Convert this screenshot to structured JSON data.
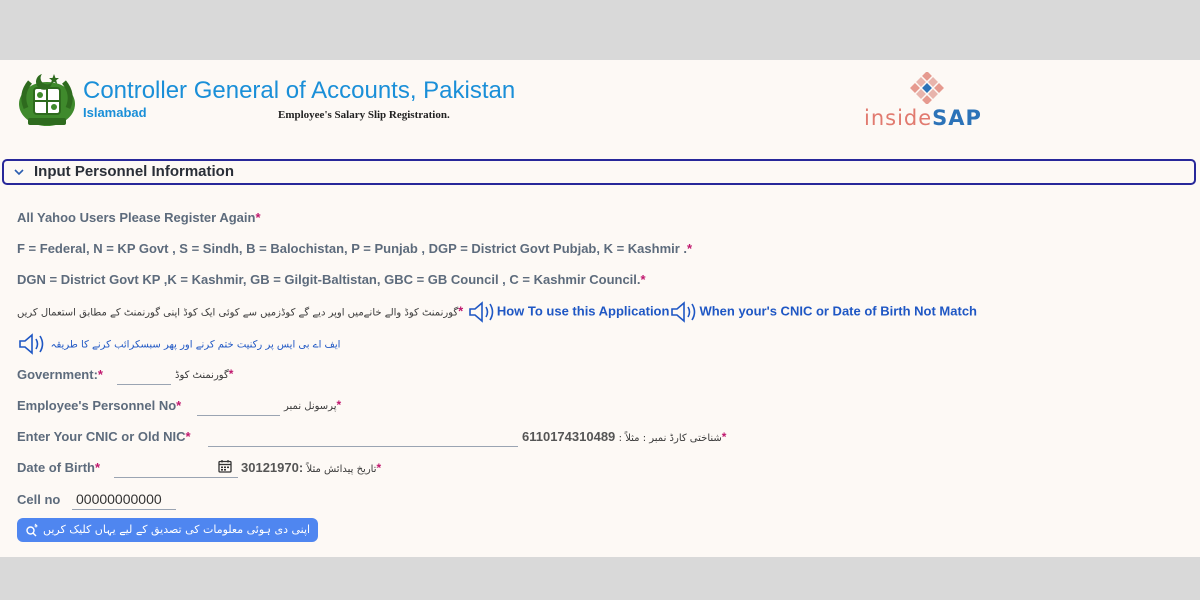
{
  "header": {
    "org_title": "Controller General of Accounts, Pakistan",
    "org_city": "Islamabad",
    "subtitle": "Employee's Salary Slip Registration.",
    "brand_inside": "inside",
    "brand_sap": "SAP"
  },
  "section": {
    "title": "Input Personnel Information",
    "border_color": "#28289a"
  },
  "notices": {
    "yahoo": "All Yahoo Users Please Register Again",
    "codes_line1": "F = Federal, N = KP Govt , S = Sindh, B = Balochistan, P = Punjab , DGP = District Govt Pubjab, K = Kashmir .",
    "codes_line2": "DGN = District Govt KP ,K = Kashmir, GB = Gilgit-Baltistan, GBC = GB Council , C = Kashmir Council.",
    "urdu_code_hint": "گورنمنٹ کوڈ والے خانےمیں اوپر دیے گے کوڈزمیں سے کوئی ایک کوڈ اپنی گورنمنٹ کے مطابق استعمال کریں",
    "link_how_to": "How To use this Application",
    "link_cnic_mismatch": "When your's CNIC or Date of Birth Not Match",
    "urdu_fbr_hint": "ایف اے بی ایس",
    "urdu_fbr_hint_full": "ایف اے بی ایس پر رکنیت ختم کرنے اور پھر سبسکرائب کرنے کا طریقہ"
  },
  "form": {
    "government": {
      "label": "Government:",
      "urdu": "گورنمنٹ کوڈ",
      "value": ""
    },
    "personnel": {
      "label": "Employee's Personnel No",
      "urdu": "پرسونل نمبر",
      "value": ""
    },
    "cnic": {
      "label": "Enter Your CNIC or Old NIC",
      "example": "6110174310489",
      "urdu": ": شناختی کارڈ نمبر : مثلاً",
      "value": ""
    },
    "dob": {
      "label": "Date of Birth",
      "example": "30121970:",
      "urdu": "تاریخ پیدائش مثلاً",
      "value": ""
    },
    "cell": {
      "label": "Cell no",
      "value": "00000000000"
    }
  },
  "verify_button": {
    "label": "اپنی دی ہوئی معلومات کی تصدیق کے لیے یہاں کلیک کریں"
  },
  "colors": {
    "accent_blue": "#1a8fd8",
    "link_blue": "#1f57c4",
    "required_star": "#c0186e",
    "button_blue": "#4f86f0"
  },
  "icons": [
    "emblem-icon",
    "sap-logo-icon",
    "chevron-down-icon",
    "speaker-icon",
    "calendar-icon",
    "search-key-icon"
  ]
}
